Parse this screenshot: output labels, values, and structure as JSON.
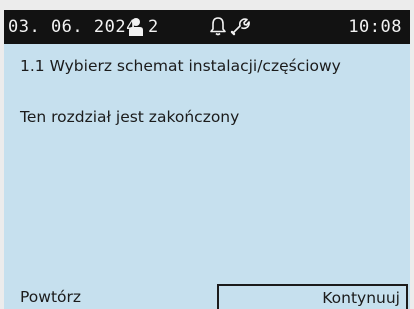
{
  "status_bar": {
    "date": "03. 06. 2024",
    "user_icon": "person-icon",
    "user_count": "2",
    "notification_icon": "bell-icon",
    "service_icon": "wrench-icon",
    "time": "10:08"
  },
  "content": {
    "title": "1.1 Wybierz schemat instalacji/częściowy",
    "message": "Ten rozdział jest zakończony"
  },
  "footer": {
    "repeat_label": "Powtórz",
    "continue_label": "Kontynuuj"
  },
  "colors": {
    "screen_background": "#c6e0ee",
    "status_bar_background": "#121212",
    "text": "#1b1b1b"
  }
}
